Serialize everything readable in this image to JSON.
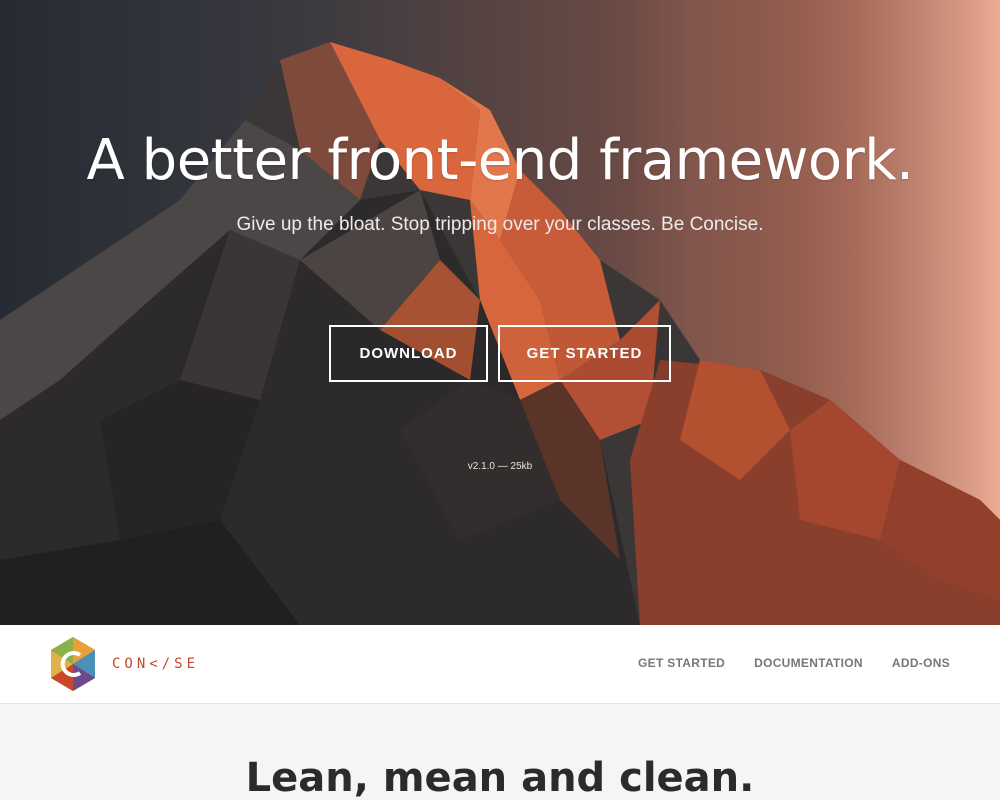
{
  "hero": {
    "title": "A better front-end framework.",
    "subtitle": "Give up the bloat. Stop tripping over your classes. Be Concise.",
    "buttons": {
      "download": "DOWNLOAD",
      "get_started": "GET STARTED"
    },
    "version": "v2.1.0 — 25kb"
  },
  "brand": {
    "name": "CON</SE",
    "logo_icon": "hexagon-c-logo-icon",
    "accent_color": "#c8472a"
  },
  "nav": {
    "items": [
      {
        "label": "GET STARTED"
      },
      {
        "label": "DOCUMENTATION"
      },
      {
        "label": "ADD-ONS"
      }
    ]
  },
  "section": {
    "title": "Lean, mean and clean."
  }
}
